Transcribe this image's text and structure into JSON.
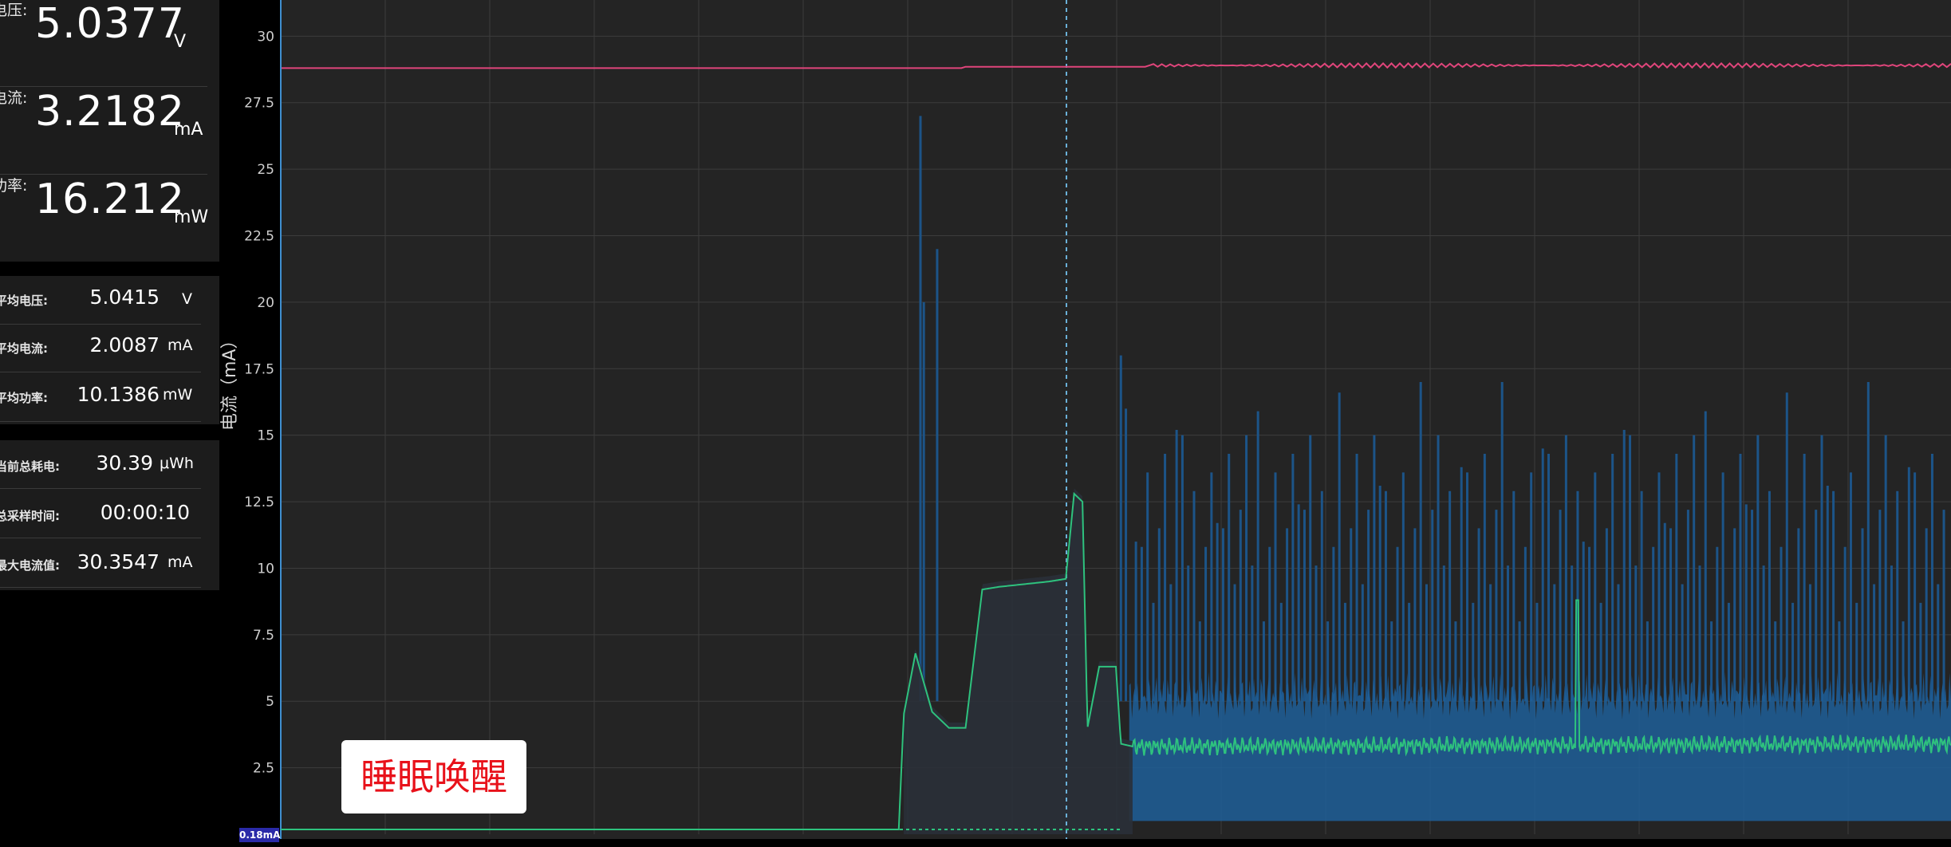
{
  "measurements": {
    "voltage": {
      "label": "电压:",
      "value": "5.0377",
      "unit": "V"
    },
    "current": {
      "label": "电流:",
      "value": "3.2182",
      "unit": "mA"
    },
    "power": {
      "label": "功率:",
      "value": "16.212",
      "unit": "mW"
    }
  },
  "averages": {
    "avg_voltage": {
      "label": "平均电压:",
      "value": "5.0415",
      "unit": "V"
    },
    "avg_current": {
      "label": "平均电流:",
      "value": "2.0087",
      "unit": "mA"
    },
    "avg_power": {
      "label": "平均功率:",
      "value": "10.1386",
      "unit": "mW"
    }
  },
  "totals": {
    "total_energy": {
      "label": "当前总耗电:",
      "value": "30.39",
      "unit": "μWh"
    },
    "sample_time": {
      "label": "总采样时间:",
      "value": "00:00:10",
      "unit": ""
    },
    "max_current": {
      "label": "最大电流值:",
      "value": "30.3547",
      "unit": "mA"
    }
  },
  "chart": {
    "ylabel": "电流（mA）",
    "annotation": "睡眠唤醒",
    "marker_label": "0.18mA",
    "colors": {
      "background": "#242424",
      "grid": "#3c3c3c",
      "voltage_line": "#e0457b",
      "current_line": "#2ec27e",
      "current_fill": "#1f5f99",
      "cursor": "#6ab0d8"
    }
  },
  "chart_data": {
    "type": "line",
    "xlabel": "",
    "ylabel": "电流（mA）",
    "ylim": [
      0,
      31
    ],
    "yticks": [
      2.5,
      5,
      7.5,
      10,
      12.5,
      15,
      17.5,
      20,
      22.5,
      25,
      27.5,
      30
    ],
    "grid": true,
    "series": [
      {
        "name": "",
        "color": "#e0457b",
        "x": [
          0,
          0.4,
          0.41,
          0.51,
          0.52,
          1.0
        ],
        "values": [
          28.8,
          28.8,
          28.85,
          28.85,
          28.9,
          28.9
        ]
      },
      {
        "name": "",
        "color": "#2ec27e",
        "x": [
          0,
          0.37,
          0.373,
          0.38,
          0.39,
          0.4,
          0.41,
          0.42,
          0.43,
          0.46,
          0.47,
          0.475,
          0.48,
          0.483,
          0.49,
          0.5,
          0.503,
          0.51,
          1.0
        ],
        "values": [
          0.18,
          0.18,
          4.5,
          6.8,
          4.6,
          4.0,
          4.0,
          9.2,
          9.3,
          9.5,
          9.6,
          12.8,
          12.5,
          4.0,
          6.3,
          6.3,
          3.4,
          3.3,
          3.4
        ]
      }
    ]
  }
}
